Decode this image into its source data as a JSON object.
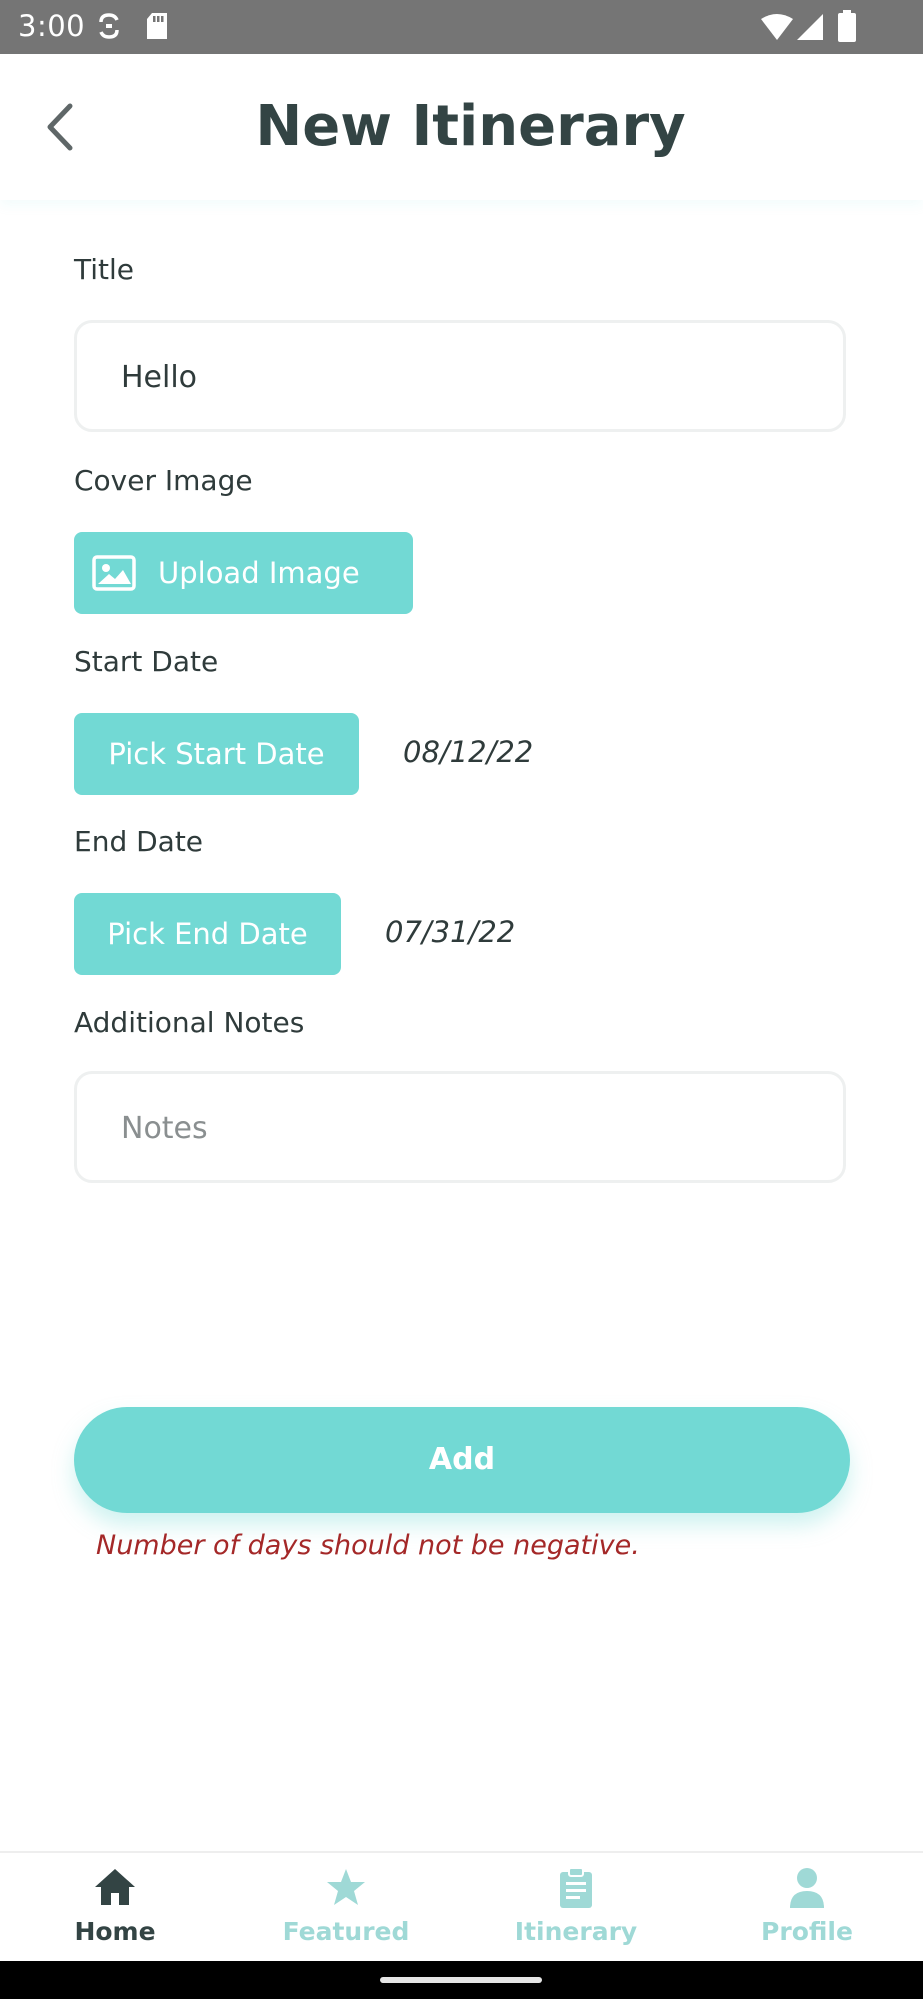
{
  "status_bar": {
    "time": "3:00"
  },
  "header": {
    "title": "New Itinerary"
  },
  "form": {
    "title_label": "Title",
    "title_value": "Hello",
    "cover_label": "Cover Image",
    "upload_label": "Upload Image",
    "start_label": "Start Date",
    "start_button": "Pick Start Date",
    "start_value": "08/12/22",
    "end_label": "End Date",
    "end_button": "Pick End Date",
    "end_value": "07/31/22",
    "notes_label": "Additional Notes",
    "notes_placeholder": "Notes",
    "notes_value": ""
  },
  "actions": {
    "add_label": "Add",
    "error_message": "Number of days should not be negative."
  },
  "bottom_nav": {
    "items": [
      {
        "label": "Home",
        "icon": "home-icon",
        "active": true
      },
      {
        "label": "Featured",
        "icon": "star-icon",
        "active": false
      },
      {
        "label": "Itinerary",
        "icon": "clipboard-icon",
        "active": false
      },
      {
        "label": "Profile",
        "icon": "person-icon",
        "active": false
      }
    ]
  },
  "colors": {
    "accent": "#72d9d4",
    "nav_inactive": "#9fd9d6",
    "title_text": "#334444",
    "error": "#a42828",
    "status_bar": "#757575"
  }
}
